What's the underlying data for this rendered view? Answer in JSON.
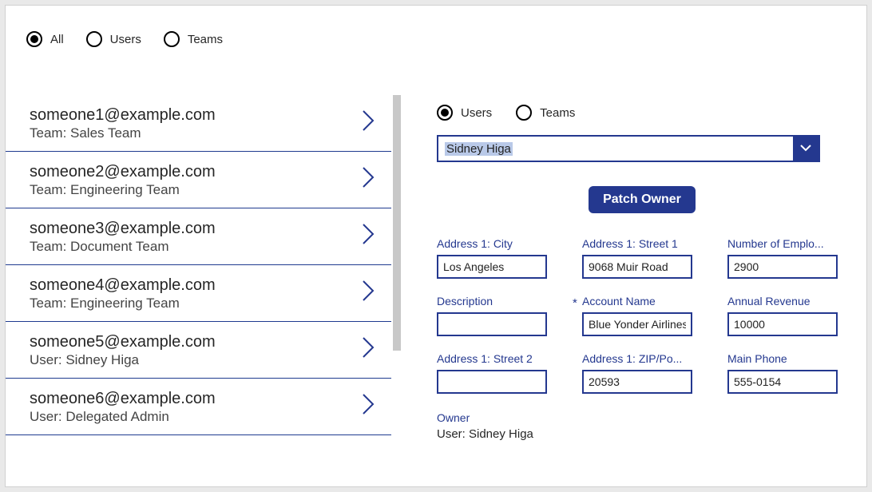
{
  "top_filter": {
    "options": [
      {
        "label": "All",
        "selected": true
      },
      {
        "label": "Users",
        "selected": false
      },
      {
        "label": "Teams",
        "selected": false
      }
    ]
  },
  "list": [
    {
      "title": "someone1@example.com",
      "sub": "Team: Sales Team"
    },
    {
      "title": "someone2@example.com",
      "sub": "Team: Engineering Team"
    },
    {
      "title": "someone3@example.com",
      "sub": "Team: Document Team"
    },
    {
      "title": "someone4@example.com",
      "sub": "Team: Engineering Team"
    },
    {
      "title": "someone5@example.com",
      "sub": "User: Sidney Higa"
    },
    {
      "title": "someone6@example.com",
      "sub": "User: Delegated Admin"
    }
  ],
  "right_filter": {
    "options": [
      {
        "label": "Users",
        "selected": true
      },
      {
        "label": "Teams",
        "selected": false
      }
    ]
  },
  "combo": {
    "value": "Sidney Higa"
  },
  "patch_button": "Patch Owner",
  "fields": [
    {
      "label": "Address 1: City",
      "value": "Los Angeles",
      "required": false
    },
    {
      "label": "Address 1: Street 1",
      "value": "9068 Muir Road",
      "required": false
    },
    {
      "label": "Number of Emplo...",
      "value": "2900",
      "required": false
    },
    {
      "label": "Description",
      "value": "",
      "required": false
    },
    {
      "label": "Account Name",
      "value": "Blue Yonder Airlines",
      "required": true
    },
    {
      "label": "Annual Revenue",
      "value": "10000",
      "required": false
    },
    {
      "label": "Address 1: Street 2",
      "value": "",
      "required": false
    },
    {
      "label": "Address 1: ZIP/Po...",
      "value": "20593",
      "required": false
    },
    {
      "label": "Main Phone",
      "value": "555-0154",
      "required": false
    }
  ],
  "owner": {
    "label": "Owner",
    "value": "User: Sidney Higa"
  }
}
